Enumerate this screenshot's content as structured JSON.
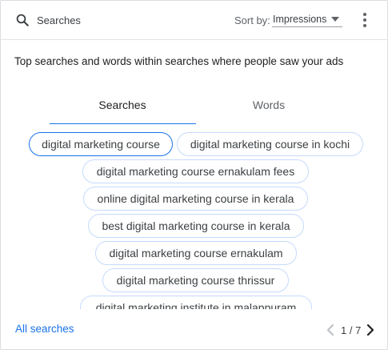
{
  "header": {
    "title": "Searches",
    "sort_label": "Sort by:",
    "sort_value": "Impressions",
    "icons": [
      "search-icon",
      "chevron-down-icon",
      "more-vert-icon"
    ]
  },
  "description": "Top searches and words within searches where people saw your ads",
  "tabs": [
    {
      "label": "Searches",
      "active": true
    },
    {
      "label": "Words",
      "active": false
    }
  ],
  "chips": [
    {
      "label": "digital marketing course",
      "selected": true
    },
    {
      "label": "digital marketing course in kochi",
      "selected": false
    },
    {
      "label": "digital marketing course ernakulam fees",
      "selected": false
    },
    {
      "label": "online digital marketing course in kerala",
      "selected": false
    },
    {
      "label": "best digital marketing course in kerala",
      "selected": false
    },
    {
      "label": "digital marketing course ernakulam",
      "selected": false
    },
    {
      "label": "digital marketing course thrissur",
      "selected": false
    },
    {
      "label": "digital marketing institute in malappuram",
      "selected": false
    }
  ],
  "footer": {
    "all_searches_link": "All searches",
    "page_indicator": "1 / 7",
    "current_page": 1,
    "total_pages": 7,
    "icons": [
      "chevron-left-icon",
      "chevron-right-icon"
    ]
  },
  "colors": {
    "accent": "#1a73e8",
    "chip_border": "#c6dafc",
    "text": "#3c4043",
    "disabled_icon": "#bdc1c6"
  }
}
